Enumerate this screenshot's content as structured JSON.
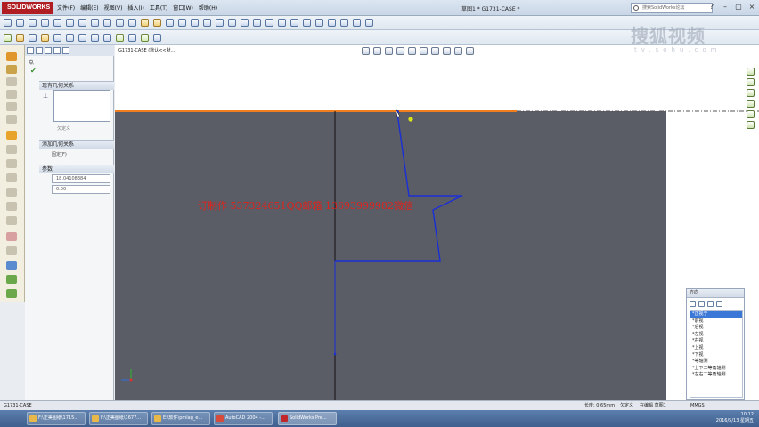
{
  "app": {
    "logo_text": "SOLIDWORKS",
    "menu": [
      "文件(F)",
      "编辑(E)",
      "视图(V)",
      "插入(I)",
      "工具(T)",
      "窗口(W)",
      "帮助(H)"
    ],
    "document_title": "草图1 * G1731-CASE *",
    "search_placeholder": "搜索SolidWorks论坛"
  },
  "window_buttons": [
    "?",
    "–",
    "▢",
    "×"
  ],
  "watermark": {
    "main": "搜狐视频",
    "sub": "tv.sohu.com"
  },
  "property_manager": {
    "header": "点",
    "existing_relations_title": "现有几何关系",
    "relations_hint": "欠定义",
    "add_relations_title": "添加几何关系",
    "fix_label": "固定(F)",
    "parameters_title": "参数",
    "x_value": "18.04108384",
    "y_value": "0.00"
  },
  "tree_path": "G1731-CASE (默认<<默...",
  "overlay_text": "订制作 537324651QQ邮箱 13693999982微信",
  "view_panel": {
    "title": "方向",
    "items": [
      "*正视于",
      "*前视",
      "*后视",
      "*左视",
      "*右视",
      "*上视",
      "*下视",
      "*等轴测",
      "*上下二等角轴测",
      "*左右二等角轴测"
    ],
    "selected_index": 0
  },
  "status": {
    "doc_name": "G1731-CASE",
    "length": "长度: 0.65mm",
    "state": "欠定义",
    "editing": "在编辑 草图1",
    "units": "MMGS"
  },
  "taskbar": {
    "buttons": [
      "F:\\正美图纸\\1715...",
      "F:\\正美图纸\\1677...",
      "E:\\软件\\pmlag_e...",
      "AutoCAD 2004 -...",
      "SolidWorks Pre..."
    ],
    "time": "10:12",
    "date": "2016/5/13 星期五"
  }
}
